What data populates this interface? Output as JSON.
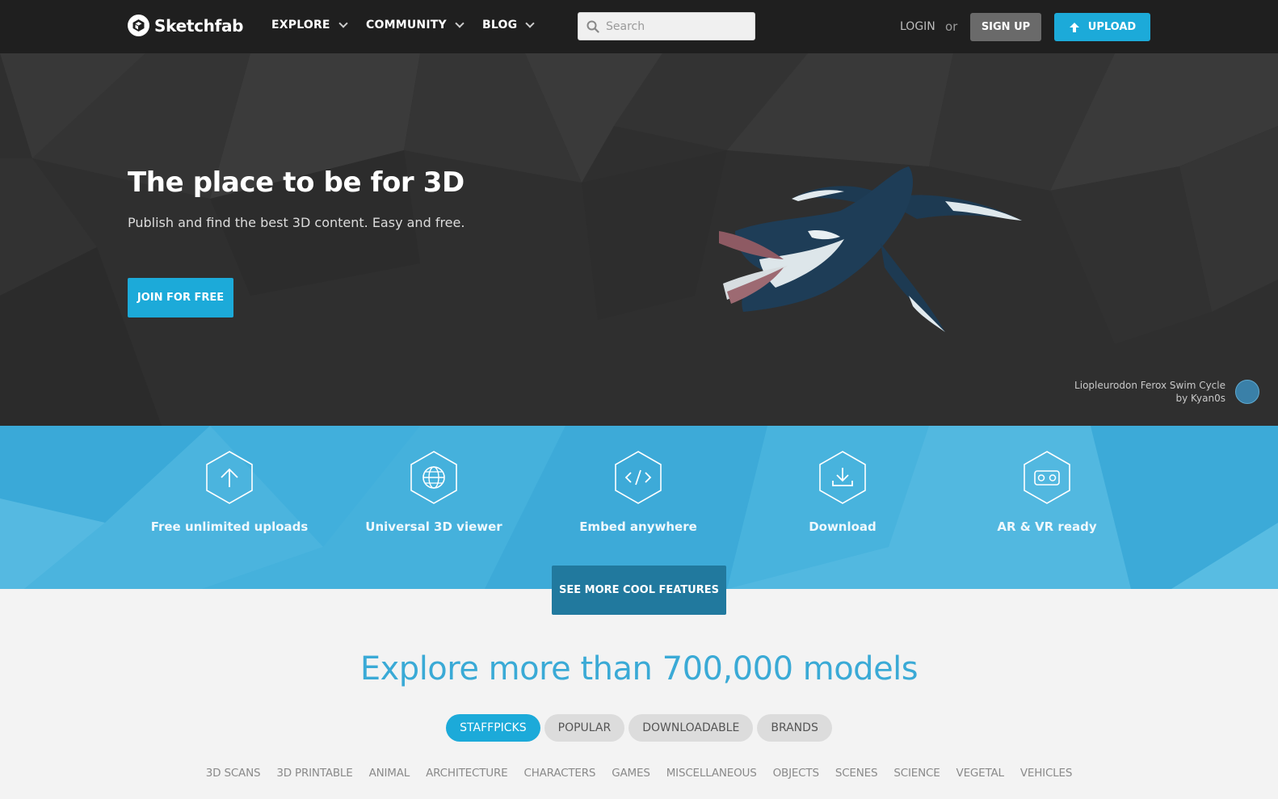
{
  "nav": {
    "logo_text": "Sketchfab",
    "items": [
      {
        "label": "EXPLORE"
      },
      {
        "label": "COMMUNITY"
      },
      {
        "label": "BLOG"
      }
    ],
    "search_placeholder": "Search",
    "login_label": "LOGIN",
    "or_label": "or",
    "signup_label": "SIGN UP",
    "upload_label": "UPLOAD"
  },
  "hero": {
    "title": "The place to be for 3D",
    "subtitle": "Publish and find the best 3D content. Easy and free.",
    "cta_label": "JOIN FOR FREE",
    "credit_title": "Liopleurodon Ferox Swim Cycle",
    "credit_author": "by Kyan0s"
  },
  "features": {
    "items": [
      {
        "label": "Free unlimited uploads",
        "icon": "upload-icon"
      },
      {
        "label": "Universal 3D viewer",
        "icon": "globe-icon"
      },
      {
        "label": "Embed anywhere",
        "icon": "code-icon"
      },
      {
        "label": "Download",
        "icon": "download-icon"
      },
      {
        "label": "AR & VR ready",
        "icon": "vr-headset-icon"
      }
    ],
    "more_label": "SEE MORE COOL FEATURES"
  },
  "explore": {
    "title": "Explore more than 700,000 models",
    "filters": [
      "STAFFPICKS",
      "POPULAR",
      "DOWNLOADABLE",
      "BRANDS"
    ],
    "active_filter": "STAFFPICKS",
    "categories": [
      "3D SCANS",
      "3D PRINTABLE",
      "ANIMAL",
      "ARCHITECTURE",
      "CHARACTERS",
      "GAMES",
      "MISCELLANEOUS",
      "OBJECTS",
      "SCENES",
      "SCIENCE",
      "VEGETAL",
      "VEHICLES"
    ]
  },
  "colors": {
    "accent": "#1caad9",
    "nav_bg": "#1f1f1f",
    "hero_bg": "#2f2f2f",
    "features_bg": "#41afdc"
  }
}
